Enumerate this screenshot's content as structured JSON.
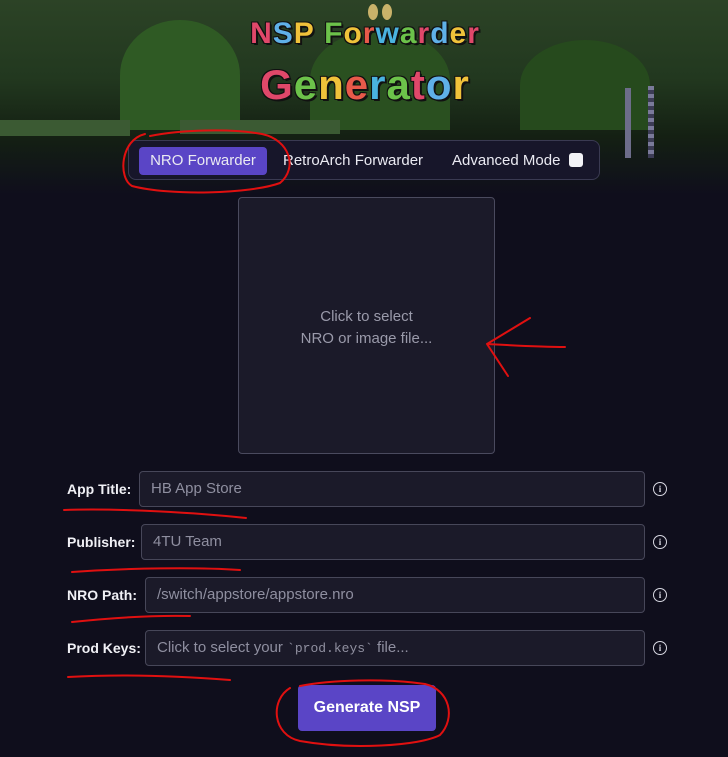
{
  "logo": {
    "line1": "NSP Forwarder",
    "line2": "Generator",
    "colors": [
      "#e0486a",
      "#5fb0e8",
      "#f0c23a",
      "#e0486a",
      "#6cc24a",
      "#f0c23a",
      "#e85a4a",
      "#4ab3e0",
      "#6cc24a"
    ]
  },
  "tabs": {
    "nro": "NRO Forwarder",
    "retroarch": "RetroArch Forwarder",
    "advanced": "Advanced Mode"
  },
  "dropzone": {
    "line1": "Click to select",
    "line2": "NRO or image file..."
  },
  "form": {
    "app_title": {
      "label": "App Title:",
      "value": "HB App Store"
    },
    "publisher": {
      "label": "Publisher:",
      "value": "4TU Team"
    },
    "nro_path": {
      "label": "NRO Path:",
      "value": "/switch/appstore/appstore.nro"
    },
    "prod_keys": {
      "label": "Prod Keys:",
      "prefix": "Click to select your ",
      "code": "`prod.keys`",
      "suffix": " file..."
    }
  },
  "generate_label": "Generate NSP",
  "info_icon": "i",
  "colors": {
    "accent": "#5a45c6",
    "background": "#0f0e1c",
    "annotation": "#e01010"
  }
}
